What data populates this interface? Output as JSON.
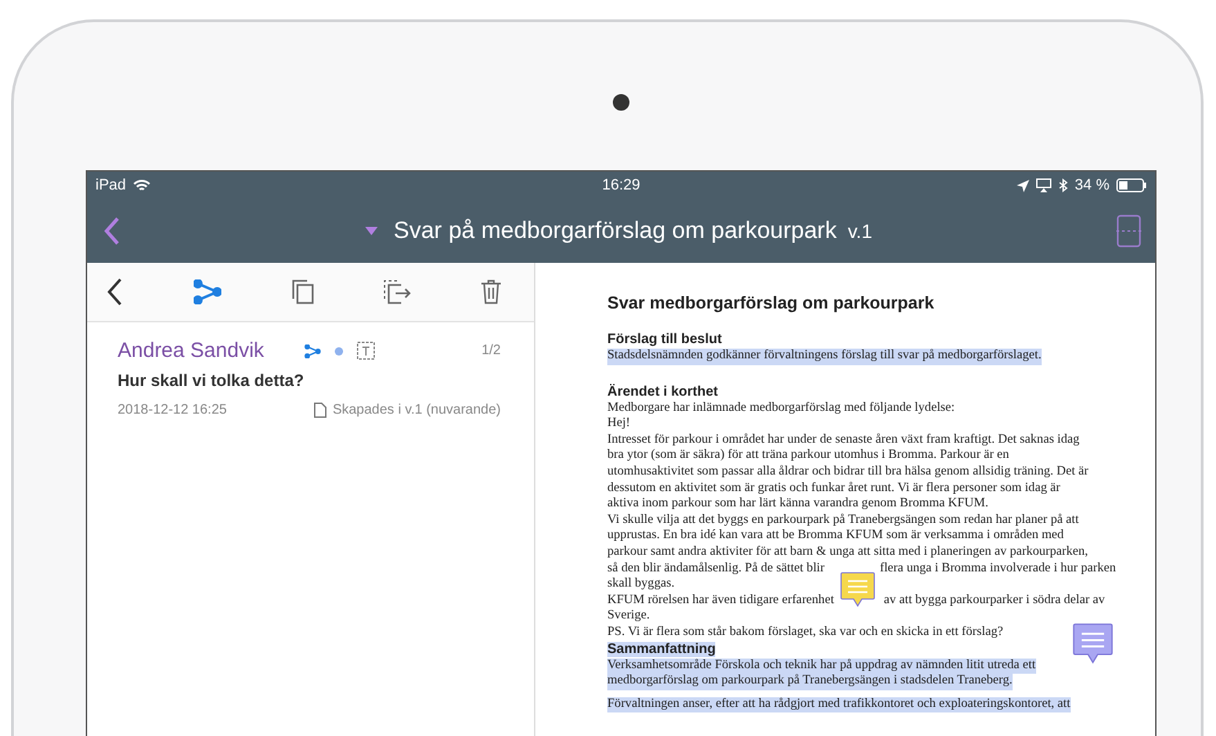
{
  "status_bar": {
    "device": "iPad",
    "time": "16:29",
    "battery": "34 %"
  },
  "nav": {
    "title": "Svar på medborgarförslag om parkourpark",
    "version": "v.1"
  },
  "toolbar": {
    "branch_selected": true
  },
  "comment": {
    "author": "Andrea Sandvik",
    "count": "1/2",
    "text": "Hur skall vi tolka detta?",
    "date": "2018-12-12 16:25",
    "version_note": "Skapades i v.1 (nuvarande)"
  },
  "doc": {
    "title": "Svar medborgarförslag om parkourpark",
    "blocks": [
      {
        "kind": "heading",
        "text": "Förslag till beslut",
        "highlighted": false
      },
      {
        "kind": "line",
        "text": "Stadsdelsnämnden godkänner förvaltningens förslag till svar på medborgarförslaget.",
        "highlighted": true
      },
      {
        "kind": "heading",
        "text": "Ärendet i korthet",
        "highlighted": false,
        "gap": true
      },
      {
        "kind": "line",
        "text": "Medborgare har inlämnade medborgarförslag med följande lydelse:",
        "highlighted": false
      },
      {
        "kind": "line",
        "text": "Hej!",
        "highlighted": false
      },
      {
        "kind": "line",
        "text": "Intresset för parkour i området har under de senaste åren växt fram kraftigt. Det saknas idag",
        "highlighted": false
      },
      {
        "kind": "line",
        "text": "bra ytor (som är säkra) för att träna parkour utomhus i Bromma. Parkour är en",
        "highlighted": false
      },
      {
        "kind": "line",
        "text": "utomhusaktivitet som passar alla åldrar och bidrar till bra hälsa genom allsidig träning. Det är",
        "highlighted": false
      },
      {
        "kind": "line",
        "text": "dessutom en aktivitet som är gratis och funkar året runt. Vi är flera personer som idag är",
        "highlighted": false
      },
      {
        "kind": "line",
        "text": "aktiva inom parkour som har lärt känna varandra genom Bromma KFUM.",
        "highlighted": false
      },
      {
        "kind": "line",
        "text": "Vi skulle vilja att det byggs en parkourpark på Tranebergsängen som redan har planer på att",
        "highlighted": false
      },
      {
        "kind": "line",
        "text": "upprustas. En bra idé kan vara att be Bromma KFUM som är verksamma i områden med",
        "highlighted": false
      },
      {
        "kind": "line",
        "text": "parkour samt andra aktiviter för att barn & unga att sitta med i planeringen av parkourparken,",
        "highlighted": false
      },
      {
        "kind": "line",
        "text": "så den blir ändamålsenlig. På de sättet blir",
        "after": "flera unga i Bromma involverade i hur parken",
        "highlighted": false
      },
      {
        "kind": "line",
        "text": "skall byggas.",
        "highlighted": false
      },
      {
        "kind": "line",
        "text": "KFUM rörelsen har även tidigare erfarenhet",
        "after": "av att bygga parkourparker i södra delar av",
        "highlighted": false,
        "note": {
          "color": "#f6d84c"
        }
      },
      {
        "kind": "line",
        "text": "Sverige.",
        "highlighted": false
      },
      {
        "kind": "line",
        "text": "PS. Vi är flera som står bakom förslaget, ska var och en skicka in ett förslag?",
        "highlighted": false,
        "note": {
          "color": "#a9a6f2"
        }
      },
      {
        "kind": "heading",
        "text": "Sammanfattning",
        "highlighted": true
      },
      {
        "kind": "line",
        "text": "Verksamhetsområde Förskola och teknik har på uppdrag av nämnden litit utreda ett",
        "highlighted": true
      },
      {
        "kind": "line",
        "text": "medborgarförslag om parkourpark på Tranebergsängen i stadsdelen Traneberg.",
        "highlighted": true
      },
      {
        "kind": "line",
        "text": "Förvaltningen anser, efter att ha rådgjort med trafikkontoret och exploateringskontoret, att",
        "highlighted": true,
        "gap": true
      }
    ]
  }
}
